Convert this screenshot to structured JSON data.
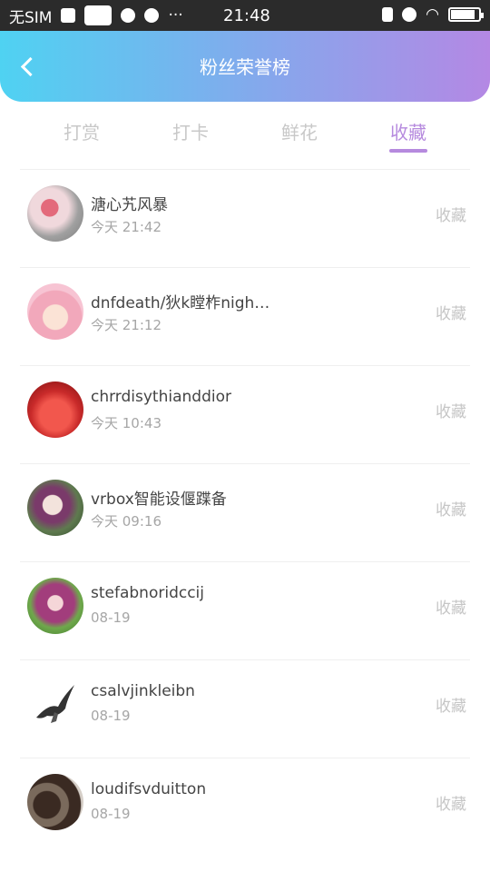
{
  "status_bar": {
    "carrier": "无SIM",
    "time": "21:48"
  },
  "header": {
    "title": "粉丝荣誉榜",
    "back_icon": "chevron-left-icon"
  },
  "tabs": [
    {
      "label": "打赏",
      "active": false
    },
    {
      "label": "打卡",
      "active": false
    },
    {
      "label": "鲜花",
      "active": false
    },
    {
      "label": "收藏",
      "active": true
    }
  ],
  "fans": [
    {
      "name": "溏心艽风暴",
      "time": "今天 21:42",
      "action": "收藏"
    },
    {
      "name": "dnfdeath/狄k瞠柞nigh…",
      "time": "今天 21:12",
      "action": "收藏"
    },
    {
      "name": "chrrdisythianddior",
      "time": "今天 10:43",
      "action": "收藏"
    },
    {
      "name": "vrbox智能设偃蹀备",
      "time": "今天 09:16",
      "action": "收藏"
    },
    {
      "name": "stefabnoridccij",
      "time": "08-19",
      "action": "收藏"
    },
    {
      "name": "csalvjinkleibn",
      "time": "08-19",
      "action": "收藏"
    },
    {
      "name": "loudifsvduitton",
      "time": "08-19",
      "action": "收藏"
    }
  ],
  "colors": {
    "accent": "#b68ade",
    "header_start": "#4fd2f2",
    "header_end": "#b488e4"
  }
}
